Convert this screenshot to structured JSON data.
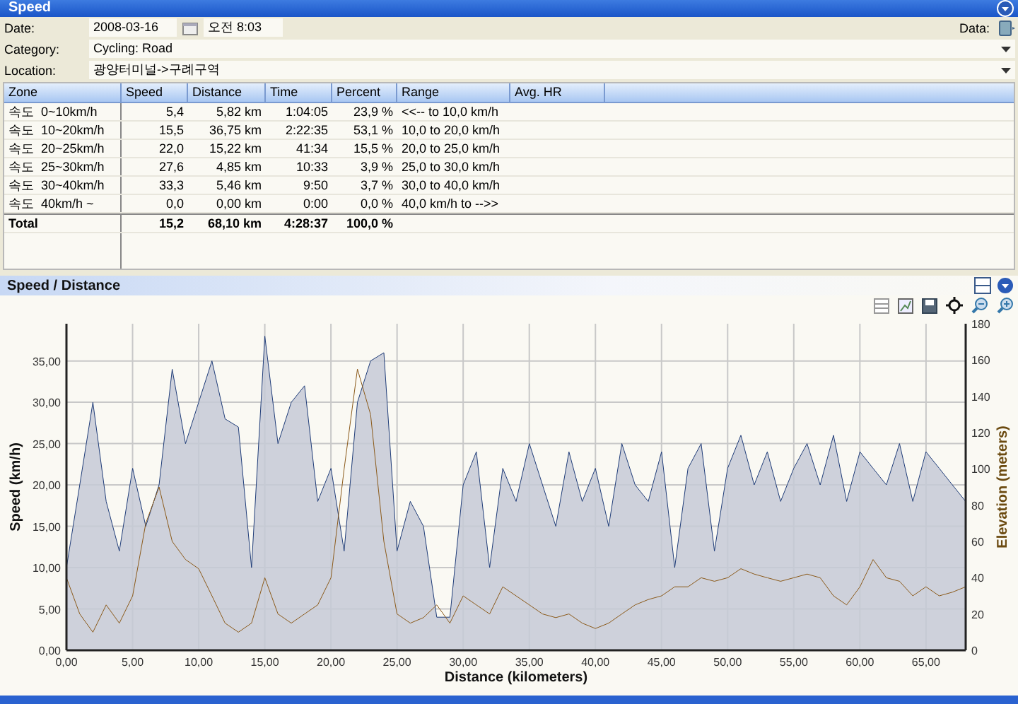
{
  "window": {
    "title": "Speed"
  },
  "form": {
    "date_label": "Date:",
    "date": "2008-03-16",
    "time": "오전 8:03",
    "data_label": "Data:",
    "category_label": "Category:",
    "category": "Cycling: Road",
    "location_label": "Location:",
    "location": "광양터미널->구례구역"
  },
  "table": {
    "columns": [
      "Zone",
      "Speed",
      "Distance",
      "Time",
      "Percent",
      "Range",
      "Avg. HR"
    ],
    "rows": [
      [
        "속도  0~10km/h",
        "5,4",
        "5,82 km",
        "1:04:05",
        "23,9 %",
        "<<-- to 10,0 km/h"
      ],
      [
        "속도  10~20km/h",
        "15,5",
        "36,75 km",
        "2:22:35",
        "53,1 %",
        "10,0 to 20,0 km/h"
      ],
      [
        "속도  20~25km/h",
        "22,0",
        "15,22 km",
        "41:34",
        "15,5 %",
        "20,0 to 25,0 km/h"
      ],
      [
        "속도  25~30km/h",
        "27,6",
        "4,85 km",
        "10:33",
        "3,9 %",
        "25,0 to 30,0 km/h"
      ],
      [
        "속도  30~40km/h",
        "33,3",
        "5,46 km",
        "9:50",
        "3,7 %",
        "30,0 to 40,0 km/h"
      ],
      [
        "속도  40km/h ~",
        "0,0",
        "0,00 km",
        "0:00",
        "0,0 %",
        "40,0 km/h to -->>"
      ]
    ],
    "total": [
      "Total",
      "15,2",
      "68,10 km",
      "4:28:37",
      "100,0 %"
    ]
  },
  "chart_panel": {
    "title": "Speed / Distance",
    "chart_data": {
      "type": "area",
      "xlabel": "Distance (kilometers)",
      "ylabel": "Speed (km/h)",
      "y2label": "Elevation (meters)",
      "x": [
        0,
        1,
        2,
        3,
        4,
        5,
        6,
        7,
        8,
        9,
        10,
        11,
        12,
        13,
        14,
        15,
        16,
        17,
        18,
        19,
        20,
        21,
        22,
        23,
        24,
        25,
        26,
        27,
        28,
        29,
        30,
        31,
        32,
        33,
        34,
        35,
        36,
        37,
        38,
        39,
        40,
        41,
        42,
        43,
        44,
        45,
        46,
        47,
        48,
        49,
        50,
        51,
        52,
        53,
        54,
        55,
        56,
        57,
        58,
        59,
        60,
        61,
        62,
        63,
        64,
        65,
        66,
        67,
        68
      ],
      "grid": true,
      "xlim": [
        0,
        68
      ],
      "ylim": [
        0,
        39.5
      ],
      "y2lim": [
        0,
        180
      ],
      "xticks": [
        {
          "value": 0,
          "label": "0,00"
        },
        {
          "value": 5,
          "label": "5,00"
        },
        {
          "value": 10,
          "label": "10,00"
        },
        {
          "value": 15,
          "label": "15,00"
        },
        {
          "value": 20,
          "label": "20,00"
        },
        {
          "value": 25,
          "label": "25,00"
        },
        {
          "value": 30,
          "label": "30,00"
        },
        {
          "value": 35,
          "label": "35,00"
        },
        {
          "value": 40,
          "label": "40,00"
        },
        {
          "value": 45,
          "label": "45,00"
        },
        {
          "value": 50,
          "label": "50,00"
        },
        {
          "value": 55,
          "label": "55,00"
        },
        {
          "value": 60,
          "label": "60,00"
        },
        {
          "value": 65,
          "label": "65,00"
        }
      ],
      "yticks": [
        {
          "value": 0,
          "label": "0,00"
        },
        {
          "value": 5,
          "label": "5,00"
        },
        {
          "value": 10,
          "label": "10,00"
        },
        {
          "value": 15,
          "label": "15,00"
        },
        {
          "value": 20,
          "label": "20,00"
        },
        {
          "value": 25,
          "label": "25,00"
        },
        {
          "value": 30,
          "label": "30,00"
        },
        {
          "value": 35,
          "label": "35,00"
        }
      ],
      "y2ticks": [
        0,
        20,
        40,
        60,
        80,
        100,
        120,
        140,
        160,
        180
      ],
      "series": [
        {
          "color": "#1f3c78",
          "values": [
            10,
            20,
            30,
            18,
            12,
            22,
            15,
            20,
            34,
            25,
            30,
            35,
            28,
            27,
            10,
            38,
            25,
            30,
            32,
            18,
            22,
            12,
            30,
            35,
            36,
            12,
            18,
            15,
            4,
            4,
            20,
            24,
            10,
            22,
            18,
            25,
            20,
            15,
            24,
            18,
            22,
            15,
            25,
            20,
            18,
            24,
            10,
            22,
            25,
            12,
            22,
            26,
            20,
            24,
            18,
            22,
            25,
            20,
            26,
            18,
            24,
            22,
            20,
            25,
            18,
            24,
            22,
            20,
            18
          ]
        },
        {
          "color": "#8b5a1a",
          "axis": "y2",
          "type": "line",
          "values": [
            40,
            20,
            10,
            25,
            15,
            30,
            70,
            90,
            60,
            50,
            45,
            30,
            15,
            10,
            15,
            40,
            20,
            15,
            20,
            25,
            40,
            100,
            155,
            130,
            60,
            20,
            15,
            18,
            25,
            15,
            30,
            25,
            20,
            35,
            30,
            25,
            20,
            18,
            20,
            15,
            12,
            15,
            20,
            25,
            28,
            30,
            35,
            35,
            40,
            38,
            40,
            45,
            42,
            40,
            38,
            40,
            42,
            40,
            30,
            25,
            35,
            50,
            40,
            38,
            30,
            35,
            30,
            32,
            35
          ]
        }
      ]
    }
  }
}
